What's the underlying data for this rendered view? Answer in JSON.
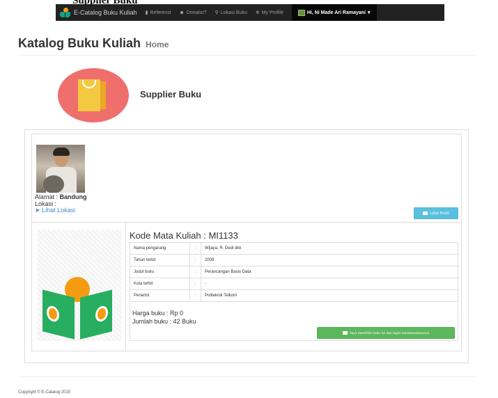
{
  "overlay": {
    "heading": "Supplier Buku"
  },
  "navbar": {
    "brand": "E-Catalog Buku Kuliah",
    "items": [
      {
        "icon": "book-icon",
        "label": "Referensi"
      },
      {
        "icon": "users-icon",
        "label": "Donatur?"
      },
      {
        "icon": "map-marker-icon",
        "label": "Lokasi Buku"
      },
      {
        "icon": "gear-icon",
        "label": "My Profile"
      }
    ],
    "user_greeting": "Hi, Ni Made Ari Ramayani"
  },
  "page": {
    "title": "Katalog Buku Kuliah",
    "subtitle": "Home"
  },
  "supplier": {
    "title": "Supplier Buku"
  },
  "profile": {
    "alamat_label": "Alamat :",
    "alamat_value": "Bandung",
    "lokasi_label": "Lokasi :",
    "lihat_lokasi": "Lihat Lokasi",
    "lihat_profil": "Lihat Profil"
  },
  "book": {
    "course_code": "Kode Mata Kuliah : MI1133",
    "details": [
      {
        "key": "Nama pengarang",
        "value": "Wijaya, R. Dedi dkk"
      },
      {
        "key": "Tahun terbit",
        "value": "2009"
      },
      {
        "key": "Judul buku",
        "value": "Perancangan Basis Data"
      },
      {
        "key": "Kota terbit",
        "value": "-"
      },
      {
        "key": "Penerbit",
        "value": "Politeknik Telkom"
      }
    ],
    "harga": "Harga buku : Rp 0",
    "jumlah": "Jumlah buku : 42 Buku",
    "donate_button": "Saya memiliki buku ini dan ingin mendonasikannya"
  },
  "footer": {
    "copyright": "Copyright © E-Catalog 2015"
  },
  "colors": {
    "navbar_bg": "#222222",
    "supplier_circle": "#ef6f6c",
    "info_button": "#5bc0de",
    "success_button": "#5cb85c",
    "link": "#428bca"
  }
}
